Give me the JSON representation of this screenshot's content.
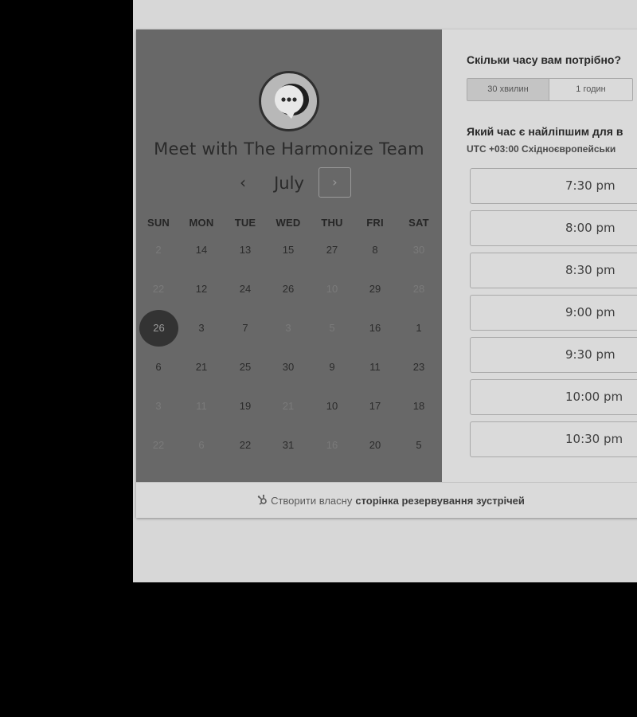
{
  "left": {
    "title": "Meet with The Harmonize Team",
    "month": "July",
    "prev_glyph": "‹",
    "next_glyph": "›",
    "days_of_week": [
      "SUN",
      "MON",
      "TUE",
      "WED",
      "THU",
      "FRI",
      "SAT"
    ],
    "weeks": [
      [
        {
          "d": "2",
          "m": true
        },
        {
          "d": "14"
        },
        {
          "d": "13"
        },
        {
          "d": "15"
        },
        {
          "d": "27"
        },
        {
          "d": "8"
        },
        {
          "d": "30",
          "m": true
        }
      ],
      [
        {
          "d": "22",
          "m": true
        },
        {
          "d": "12"
        },
        {
          "d": "24"
        },
        {
          "d": "26"
        },
        {
          "d": "10",
          "m": true
        },
        {
          "d": "29"
        },
        {
          "d": "28",
          "m": true
        }
      ],
      [
        {
          "d": "26",
          "s": true
        },
        {
          "d": "3"
        },
        {
          "d": "7"
        },
        {
          "d": "3",
          "m": true
        },
        {
          "d": "5",
          "m": true
        },
        {
          "d": "16"
        },
        {
          "d": "1"
        }
      ],
      [
        {
          "d": "6"
        },
        {
          "d": "21"
        },
        {
          "d": "25"
        },
        {
          "d": "30"
        },
        {
          "d": "9"
        },
        {
          "d": "11"
        },
        {
          "d": "23"
        }
      ],
      [
        {
          "d": "3",
          "m": true
        },
        {
          "d": "11",
          "m": true
        },
        {
          "d": "19"
        },
        {
          "d": "21",
          "m": true
        },
        {
          "d": "10"
        },
        {
          "d": "17"
        },
        {
          "d": "18"
        }
      ],
      [
        {
          "d": "22",
          "m": true
        },
        {
          "d": "6",
          "m": true
        },
        {
          "d": "22"
        },
        {
          "d": "31"
        },
        {
          "d": "16",
          "m": true
        },
        {
          "d": "20"
        },
        {
          "d": "5"
        }
      ]
    ]
  },
  "right": {
    "duration_question": "Скільки часу вам потрібно?",
    "durations": [
      "30 хвилин",
      "1 годин"
    ],
    "time_question": "Який час є найліпшим для в",
    "timezone": "UTC +03:00 Східноєвропейськи",
    "slots": [
      "7:30 pm",
      "8:00 pm",
      "8:30 pm",
      "9:00 pm",
      "9:30 pm",
      "10:00 pm",
      "10:30 pm"
    ]
  },
  "footer": {
    "prefix": "Створити власну",
    "bold": "сторінка резервування зустрічей"
  }
}
